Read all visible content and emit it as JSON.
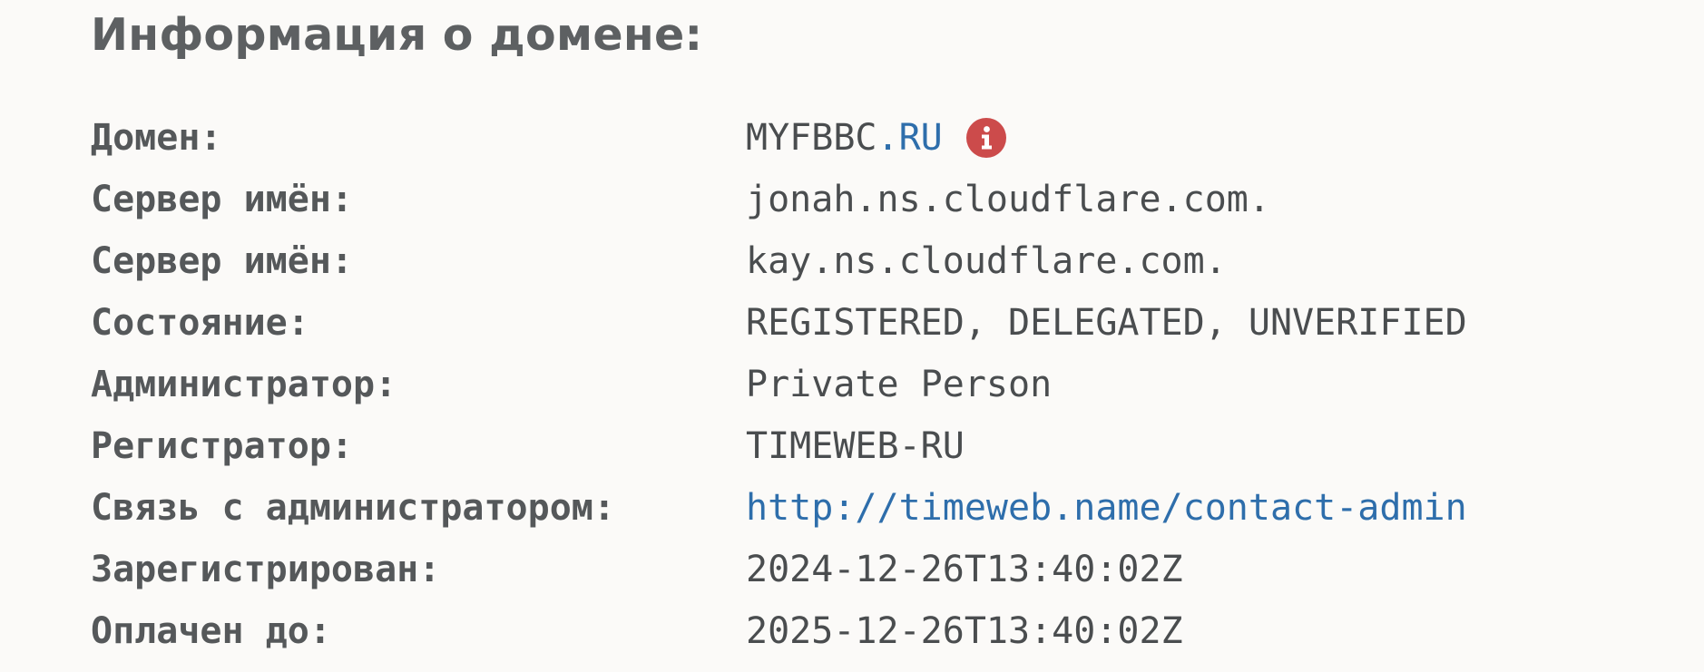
{
  "heading": "Информация о домене:",
  "colors": {
    "text": "#4a4d4f",
    "label": "#55585a",
    "link": "#2e6eab",
    "info_icon": "#cc4b4b",
    "background": "#fbfaf8"
  },
  "icons": {
    "info": "info-circle-icon"
  },
  "rows": {
    "domain": {
      "label": "Домен:",
      "name": "MYFBBC",
      "tld": ".RU"
    },
    "nameserver_1": {
      "label": "Сервер имён:",
      "value": "jonah.ns.cloudflare.com."
    },
    "nameserver_2": {
      "label": "Сервер имён:",
      "value": "kay.ns.cloudflare.com."
    },
    "state": {
      "label": "Состояние:",
      "value": "REGISTERED, DELEGATED, UNVERIFIED"
    },
    "admin": {
      "label": "Администратор:",
      "value": "Private Person"
    },
    "registrar": {
      "label": "Регистратор:",
      "value": "TIMEWEB-RU"
    },
    "admin_contact": {
      "label": "Связь с администратором:",
      "value": "http://timeweb.name/contact-admin"
    },
    "created": {
      "label": "Зарегистрирован:",
      "value": "2024-12-26T13:40:02Z"
    },
    "paid_till": {
      "label": "Оплачен до:",
      "value": "2025-12-26T13:40:02Z"
    }
  }
}
